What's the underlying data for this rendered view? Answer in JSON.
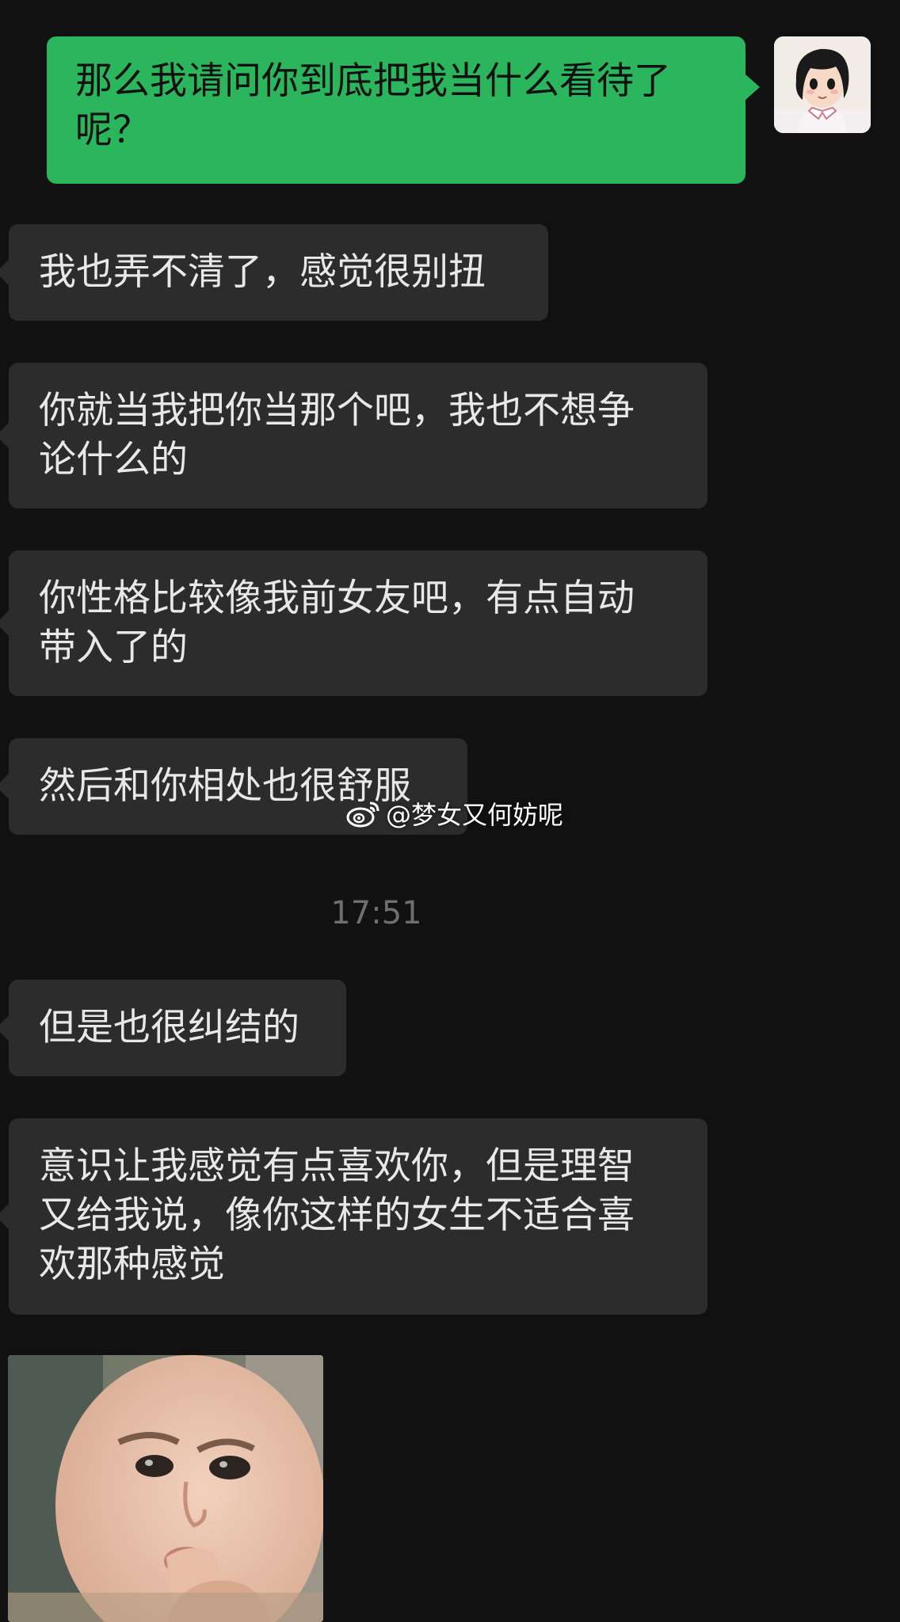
{
  "chat": {
    "messages": [
      {
        "id": "m1",
        "sender": "me",
        "text": "那么我请问你到底把我当什么看待了\n呢？"
      },
      {
        "id": "m2",
        "sender": "other",
        "text": "我也弄不清了，感觉很别扭"
      },
      {
        "id": "m3",
        "sender": "other",
        "text": "你就当我把你当那个吧，我也不想争\n论什么的"
      },
      {
        "id": "m4",
        "sender": "other",
        "text": "你性格比较像我前女友吧，有点自动\n带入了的"
      },
      {
        "id": "m5",
        "sender": "other",
        "text": "然后和你相处也很舒服"
      },
      {
        "id": "m6",
        "sender": "other",
        "text": "但是也很纠结的"
      },
      {
        "id": "m7",
        "sender": "other",
        "text": "意识让我感觉有点喜欢你，但是理智\n又给我说，像你这样的女生不适合喜\n欢那种感觉"
      }
    ],
    "timestamp": "17:51",
    "watermark": "@梦女又何妨呢"
  },
  "colors": {
    "background": "#111111",
    "incoming_bubble": "#2c2c2c",
    "outgoing_bubble": "#2bb55d",
    "timestamp": "#6f6f6f"
  },
  "icons": {
    "watermark_icon": "weibo-icon",
    "sender_avatar": "anime-girl-avatar",
    "sticker": "baby-sticker"
  }
}
